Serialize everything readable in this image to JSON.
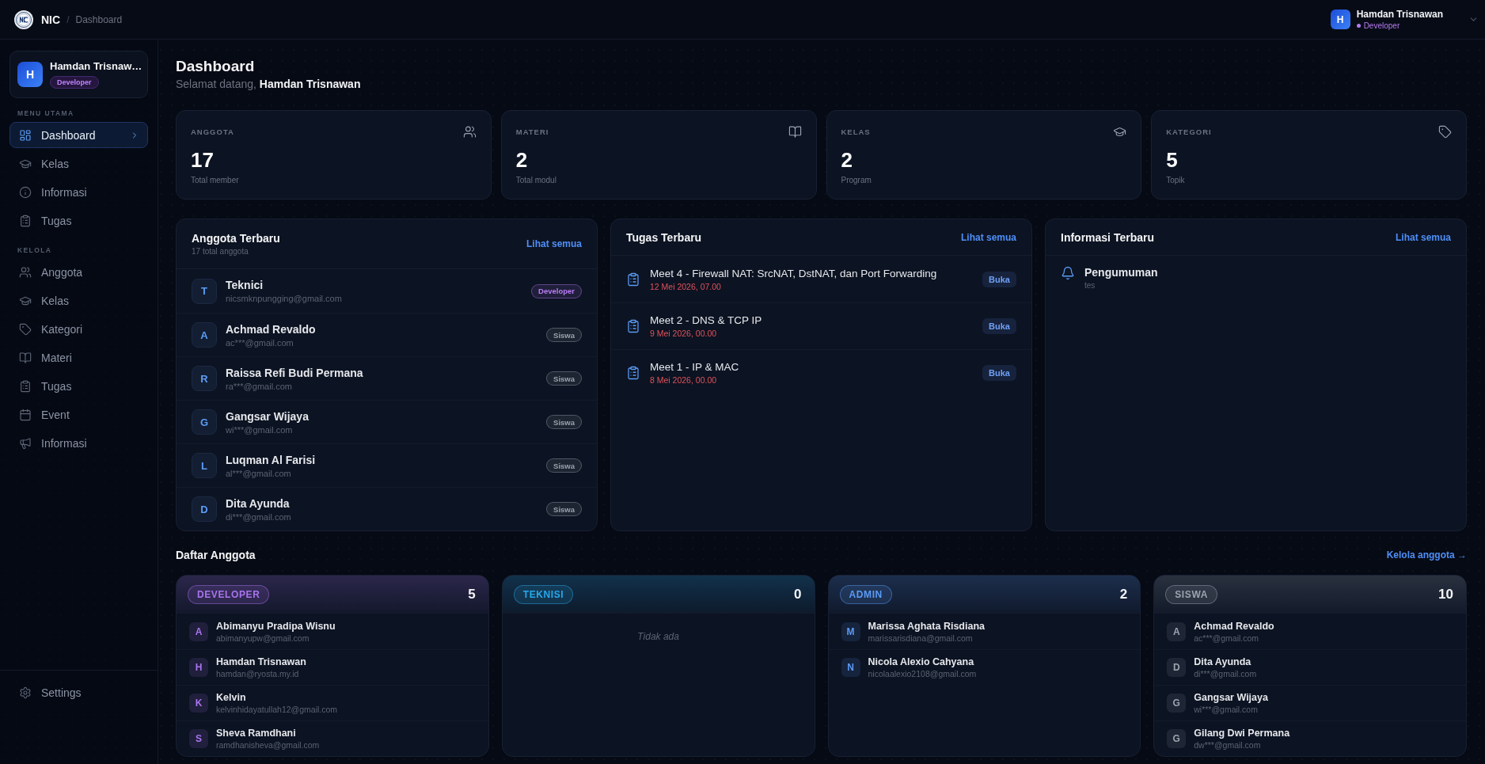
{
  "topbar": {
    "brand": "NIC",
    "separator": "/",
    "page": "Dashboard",
    "user": {
      "initial": "H",
      "name": "Hamdan Trisnawan",
      "role": "Developer"
    }
  },
  "sidebar": {
    "profile": {
      "initial": "H",
      "name": "Hamdan Trisnaw…",
      "role": "Developer"
    },
    "sections": [
      {
        "label": "MENU UTAMA",
        "items": [
          {
            "label": "Dashboard",
            "selected": true
          },
          {
            "label": "Kelas",
            "selected": false
          },
          {
            "label": "Informasi",
            "selected": false
          },
          {
            "label": "Tugas",
            "selected": false
          }
        ]
      },
      {
        "label": "KELOLA",
        "items": [
          {
            "label": "Anggota",
            "selected": false
          },
          {
            "label": "Kelas",
            "selected": false
          },
          {
            "label": "Kategori",
            "selected": false
          },
          {
            "label": "Materi",
            "selected": false
          },
          {
            "label": "Tugas",
            "selected": false
          },
          {
            "label": "Event",
            "selected": false
          },
          {
            "label": "Informasi",
            "selected": false
          }
        ]
      }
    ],
    "footer": {
      "label": "Settings"
    }
  },
  "page": {
    "title": "Dashboard",
    "greeting": "Selamat datang, **Hamdan Trisnawan**"
  },
  "stats": [
    {
      "label": "ANGGOTA",
      "value": "17",
      "caption": "Total member"
    },
    {
      "label": "MATERI",
      "value": "2",
      "caption": "Total modul"
    },
    {
      "label": "KELAS",
      "value": "2",
      "caption": "Program"
    },
    {
      "label": "KATEGORI",
      "value": "5",
      "caption": "Topik"
    }
  ],
  "recent_members": {
    "title": "Anggota Terbaru",
    "subtitle": "17 total anggota",
    "link": "Lihat semua",
    "rows": [
      {
        "initial": "T",
        "name": "Teknici",
        "email": "nicsmknpungging@gmail.com",
        "role": "Developer",
        "color": "#b97cf4"
      },
      {
        "initial": "A",
        "name": "Achmad Revaldo",
        "email": "ac***@gmail.com",
        "role": "Siswa",
        "color": "#9ca3af"
      },
      {
        "initial": "R",
        "name": "Raissa Refi Budi Permana",
        "email": "ra***@gmail.com",
        "role": "Siswa",
        "color": "#9ca3af"
      },
      {
        "initial": "G",
        "name": "Gangsar Wijaya",
        "email": "wi***@gmail.com",
        "role": "Siswa",
        "color": "#9ca3af"
      },
      {
        "initial": "L",
        "name": "Luqman Al Farisi",
        "email": "al***@gmail.com",
        "role": "Siswa",
        "color": "#9ca3af"
      },
      {
        "initial": "D",
        "name": "Dita Ayunda",
        "email": "di***@gmail.com",
        "role": "Siswa",
        "color": "#9ca3af"
      }
    ]
  },
  "recent_tasks": {
    "title": "Tugas Terbaru",
    "link": "Lihat semua",
    "rows": [
      {
        "title": "Meet 4 - Firewall NAT: SrcNAT, DstNAT, dan Port Forwarding",
        "date": "12 Mei 2026, 07.00",
        "action": "Buka"
      },
      {
        "title": "Meet 2 - DNS & TCP IP",
        "date": "9 Mei 2026, 00.00",
        "action": "Buka"
      },
      {
        "title": "Meet 1 - IP & MAC",
        "date": "8 Mei 2026, 00.00",
        "action": "Buka"
      }
    ]
  },
  "recent_info": {
    "title": "Informasi Terbaru",
    "link": "Lihat semua",
    "rows": [
      {
        "title": "Pengumuman",
        "text": "tes"
      }
    ]
  },
  "member_list": {
    "title": "Daftar Anggota",
    "link": "Kelola anggota →",
    "groups": [
      {
        "role": "DEVELOPER",
        "count": "5",
        "color": "#a974ee",
        "members": [
          {
            "initial": "A",
            "name": "Abimanyu Pradipa Wisnu",
            "email": "abimanyupw@gmail.com"
          },
          {
            "initial": "H",
            "name": "Hamdan Trisnawan",
            "email": "hamdan@ryosta.my.id"
          },
          {
            "initial": "K",
            "name": "Kelvin",
            "email": "kelvinhidayatullah12@gmail.com"
          },
          {
            "initial": "S",
            "name": "Sheva Ramdhani",
            "email": "ramdhanisheva@gmail.com"
          }
        ]
      },
      {
        "role": "TEKNISI",
        "count": "0",
        "color": "#27a9ec",
        "empty_text": "Tidak ada"
      },
      {
        "role": "ADMIN",
        "count": "2",
        "color": "#5b9bf6",
        "members": [
          {
            "initial": "M",
            "name": "Marissa Aghata Risdiana",
            "email": "marissarisdiana@gmail.com"
          },
          {
            "initial": "N",
            "name": "Nicola Alexio Cahyana",
            "email": "nicolaalexio2108@gmail.com"
          }
        ]
      },
      {
        "role": "SISWA",
        "count": "10",
        "color": "#9ca3af",
        "members": [
          {
            "initial": "A",
            "name": "Achmad Revaldo",
            "email": "ac***@gmail.com"
          },
          {
            "initial": "D",
            "name": "Dita Ayunda",
            "email": "di***@gmail.com"
          },
          {
            "initial": "G",
            "name": "Gangsar Wijaya",
            "email": "wi***@gmail.com"
          },
          {
            "initial": "G",
            "name": "Gilang Dwi Permana",
            "email": "dw***@gmail.com"
          }
        ]
      }
    ]
  }
}
